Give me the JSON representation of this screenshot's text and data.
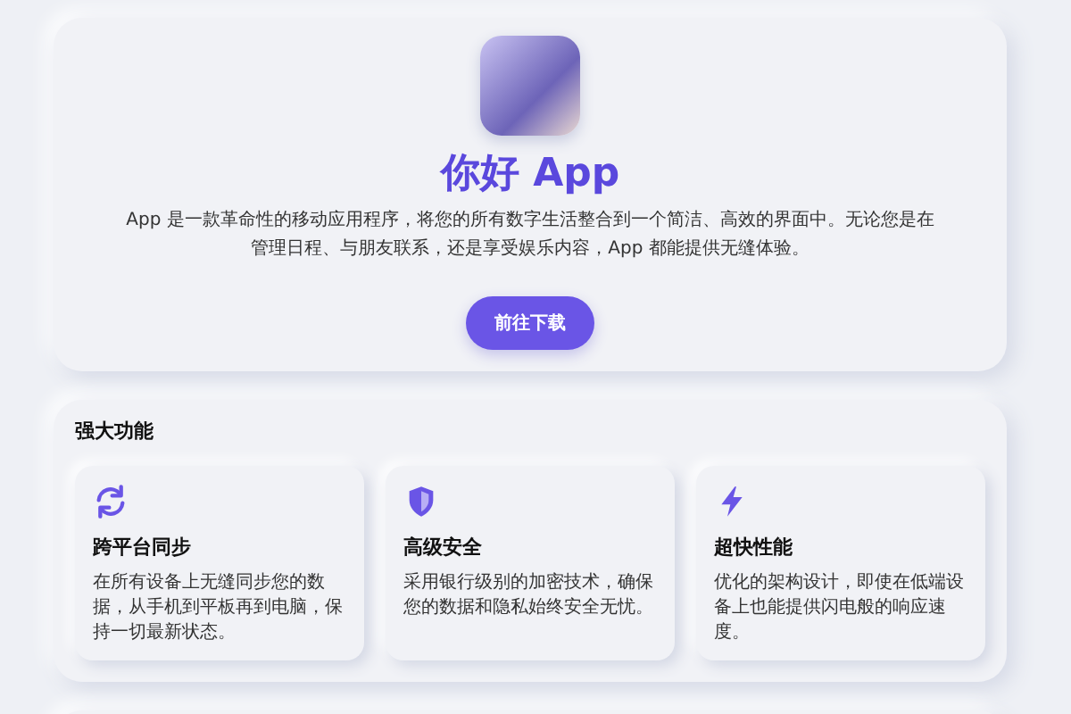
{
  "hero": {
    "title": "你好 App",
    "description": "App 是一款革命性的移动应用程序，将您的所有数字生活整合到一个简洁、高效的界面中。无论您是在管理日程、与朋友联系，还是享受娱乐内容，App 都能提供无缝体验。",
    "button": "前往下载"
  },
  "features": {
    "heading": "强大功能",
    "items": [
      {
        "kind": "sync",
        "title": "跨平台同步",
        "description": "在所有设备上无缝同步您的数据，从手机到平板再到电脑，保持一切最新状态。"
      },
      {
        "kind": "shield",
        "title": "高级安全",
        "description": "采用银行级别的加密技术，确保您的数据和隐私始终安全无忧。"
      },
      {
        "kind": "bolt",
        "title": "超快性能",
        "description": "优化的架构设计，即使在低端设备上也能提供闪电般的响应速度。"
      }
    ]
  }
}
